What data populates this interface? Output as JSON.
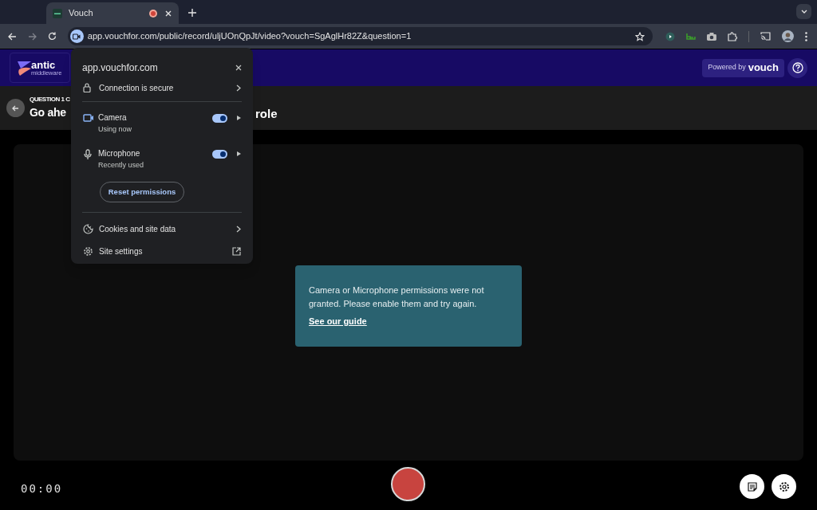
{
  "browser": {
    "tabs": [
      {
        "title": "Vouch",
        "selected": true,
        "recording": true
      }
    ],
    "url": "app.vouchfor.com/public/record/uljUOnQpJt/video?vouch=SgAglHr82Z&question=1"
  },
  "site_popup": {
    "domain": "app.vouchfor.com",
    "connection": "Connection is secure",
    "permissions": [
      {
        "kind": "camera",
        "name": "Camera",
        "status": "Using now",
        "on": true
      },
      {
        "kind": "microphone",
        "name": "Microphone",
        "status": "Recently used",
        "on": true
      }
    ],
    "reset_button": "Reset permissions",
    "links": [
      {
        "kind": "cookies",
        "label": "Cookies and site data"
      },
      {
        "kind": "settings",
        "label": "Site settings"
      }
    ]
  },
  "header": {
    "logo_text": "antic",
    "logo_subtext": "middleware",
    "powered_by": "Powered by",
    "brand": "vouch"
  },
  "question": {
    "label": "QUESTION 1 C",
    "title_start": "Go ahe",
    "title_end": "role"
  },
  "notice": {
    "message": "Camera or Microphone permissions were not granted. Please enable them and try again.",
    "link": "See our guide"
  },
  "recorder": {
    "timer": "00:00"
  }
}
